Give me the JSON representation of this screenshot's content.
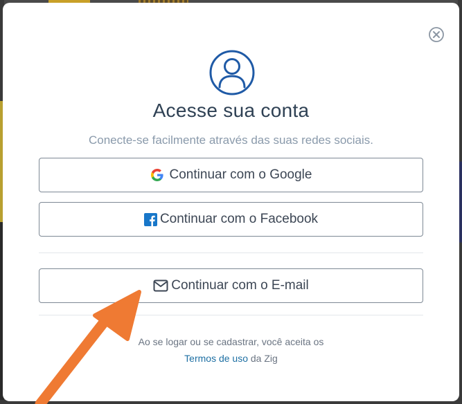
{
  "modal": {
    "title": "Acesse sua conta",
    "subtitle": "Conecte-se facilmente através das suas redes sociais.",
    "close_icon": "close-circle-icon",
    "avatar_icon": "user-avatar-icon",
    "buttons": {
      "google": {
        "label": "Continuar com o Google",
        "icon": "google-icon"
      },
      "facebook": {
        "label": "Continuar com o Facebook",
        "icon": "facebook-icon"
      },
      "email": {
        "label": "Continuar com o E-mail",
        "icon": "envelope-icon"
      }
    },
    "terms": {
      "text": "Ao se logar ou se cadastrar, você aceita os",
      "link_label": "Termos de uso",
      "suffix": " da Zig"
    }
  },
  "annotation": {
    "icon": "arrow-annotation-icon",
    "color": "#ef7a33"
  },
  "colors": {
    "title": "#2f4154",
    "subtitle": "#8a9aab",
    "avatar_blue": "#1f5aa6",
    "link": "#1d6fa3",
    "facebook_blue": "#1877c9"
  }
}
